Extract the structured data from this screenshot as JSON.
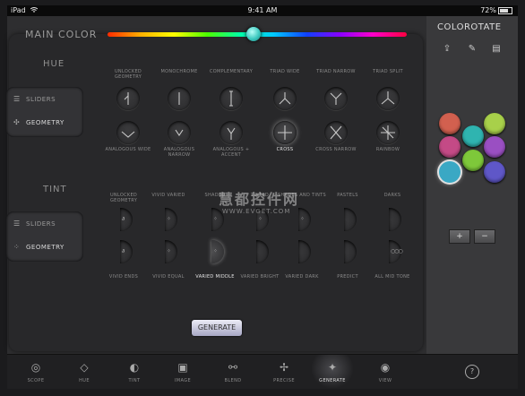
{
  "status_bar": {
    "device": "iPad",
    "time": "9:41 AM",
    "battery": "72%"
  },
  "main_color": {
    "label": "MAIN COLOR",
    "hue_percent": 49
  },
  "hue": {
    "label": "HUE",
    "modes": [
      {
        "label": "SLIDERS",
        "icon": "sliders-icon",
        "selected": false
      },
      {
        "label": "GEOMETRY",
        "icon": "geometry-icon",
        "selected": true
      }
    ],
    "presets": [
      {
        "label": "UNLOCKED GEOMETRY",
        "icon": "unlocked-geometry-icon",
        "selected": false
      },
      {
        "label": "MONOCHROME",
        "icon": "monochrome-icon",
        "selected": false
      },
      {
        "label": "COMPLEMENTARY",
        "icon": "complementary-icon",
        "selected": false
      },
      {
        "label": "TRIAD WIDE",
        "icon": "triad-wide-icon",
        "selected": false
      },
      {
        "label": "TRIAD NARROW",
        "icon": "triad-narrow-icon",
        "selected": false
      },
      {
        "label": "TRIAD SPLIT",
        "icon": "triad-split-icon",
        "selected": false
      },
      {
        "label": "ANALOGOUS WIDE",
        "icon": "analogous-wide-icon",
        "selected": false
      },
      {
        "label": "ANALOGOUS NARROW",
        "icon": "analogous-narrow-icon",
        "selected": false
      },
      {
        "label": "ANALOGOUS + ACCENT",
        "icon": "analogous-accent-icon",
        "selected": false
      },
      {
        "label": "CROSS",
        "icon": "cross-icon",
        "selected": true
      },
      {
        "label": "CROSS NARROW",
        "icon": "cross-narrow-icon",
        "selected": false
      },
      {
        "label": "RAINBOW",
        "icon": "rainbow-icon",
        "selected": false
      }
    ]
  },
  "tint": {
    "label": "TINT",
    "modes": [
      {
        "label": "SLIDERS",
        "icon": "sliders-icon",
        "selected": false
      },
      {
        "label": "GEOMETRY",
        "icon": "geometry-icon",
        "selected": true
      }
    ],
    "presets": [
      {
        "label": "UNLOCKED GEOMETRY",
        "selected": false
      },
      {
        "label": "VIVID VARIED",
        "selected": false
      },
      {
        "label": "SHADED",
        "selected": false
      },
      {
        "label": "TINTED",
        "selected": false
      },
      {
        "label": "SHADES AND TINTS",
        "selected": false
      },
      {
        "label": "PASTELS",
        "selected": false
      },
      {
        "label": "DARKS",
        "selected": false
      },
      {
        "label": "VIVID ENDS",
        "selected": false
      },
      {
        "label": "VIVID EQUAL",
        "selected": false
      },
      {
        "label": "VARIED MIDDLE",
        "selected": true
      },
      {
        "label": "VARIED BRIGHT",
        "selected": false
      },
      {
        "label": "VARIED DARK",
        "selected": false
      },
      {
        "label": "PREDICT",
        "selected": false
      },
      {
        "label": "ALL MID TONE",
        "selected": false
      }
    ]
  },
  "generate_label": "GENERATE",
  "sidebar": {
    "title": "COLOROTATE",
    "tools": [
      {
        "icon": "share-icon"
      },
      {
        "icon": "wrench-icon"
      },
      {
        "icon": "document-icon"
      }
    ],
    "swatches": [
      "#d2604f",
      "#a8d04a",
      "#c44a86",
      "#2fb4b0",
      "#9a4fc2",
      "#3aa8c4",
      "#7ec83a",
      "#5f57c8"
    ],
    "selected_swatch": 5,
    "plus": "+",
    "minus": "−"
  },
  "tabs": [
    {
      "label": "SCOPE",
      "icon": "scope-icon",
      "selected": false
    },
    {
      "label": "HUE",
      "icon": "hue-icon",
      "selected": false
    },
    {
      "label": "TINT",
      "icon": "tint-icon",
      "selected": false
    },
    {
      "label": "IMAGE",
      "icon": "image-icon",
      "selected": false
    },
    {
      "label": "BLEND",
      "icon": "blend-icon",
      "selected": false
    },
    {
      "label": "PRECISE",
      "icon": "precise-icon",
      "selected": false
    },
    {
      "label": "GENERATE",
      "icon": "generate-icon",
      "selected": true
    },
    {
      "label": "VIEW",
      "icon": "view-icon",
      "selected": false
    }
  ],
  "help": "?",
  "watermark": {
    "title": "慧都控件网",
    "url": "WWW.EVGET.COM"
  }
}
